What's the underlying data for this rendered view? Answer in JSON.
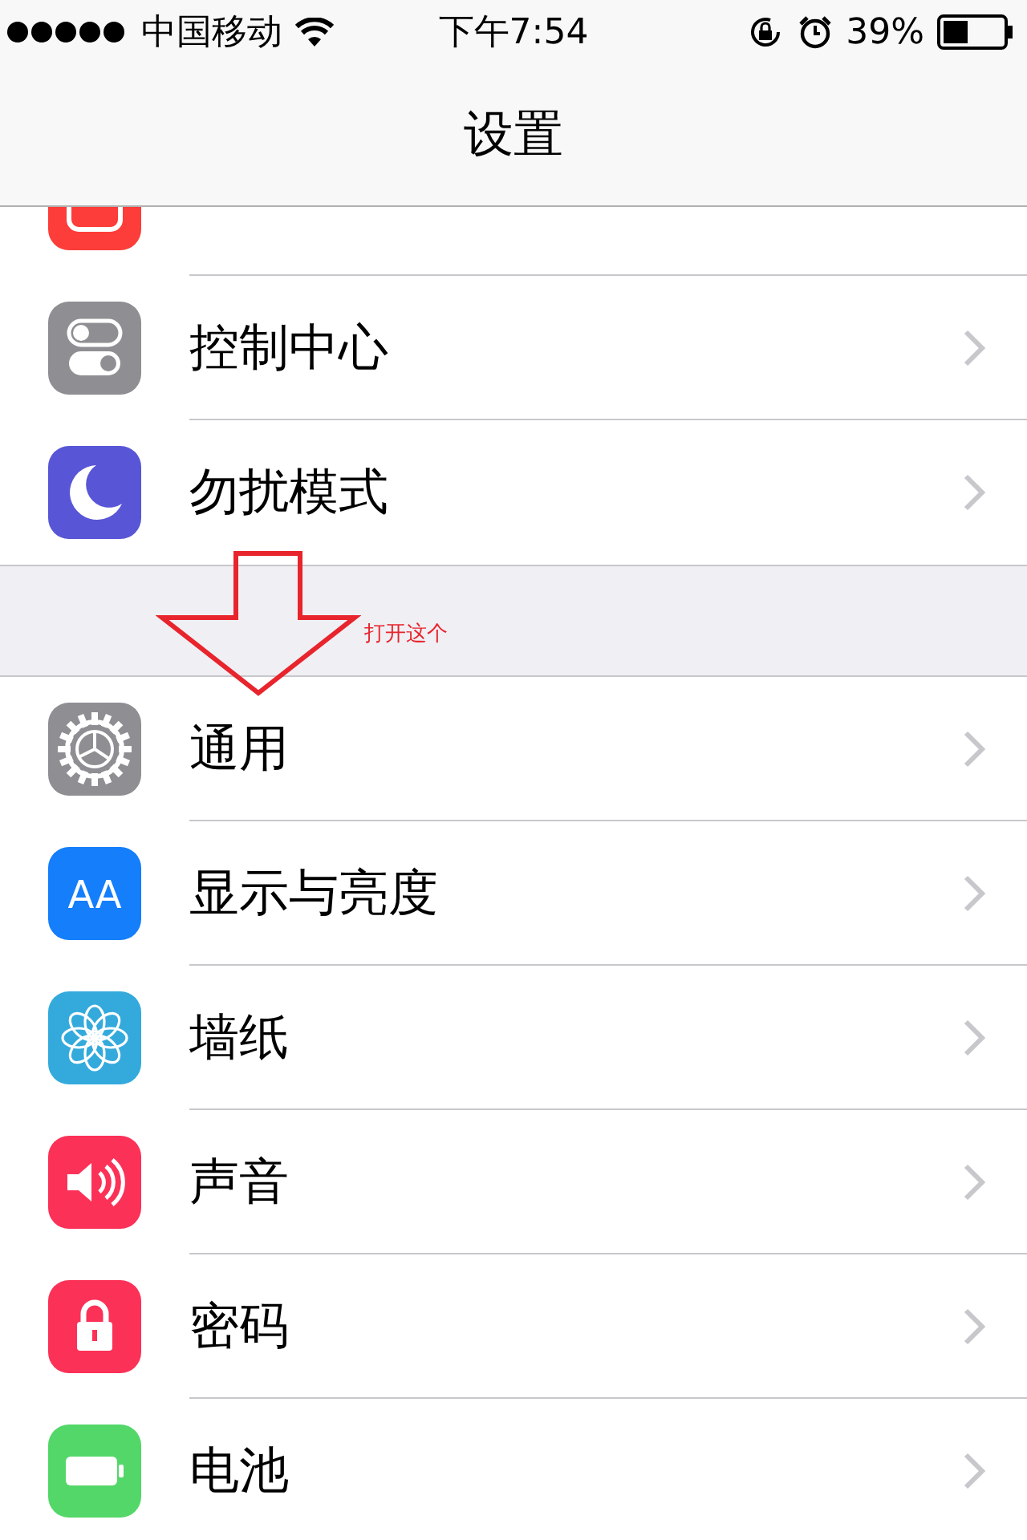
{
  "status_bar": {
    "carrier": "中国移动",
    "time": "下午7:54",
    "battery": "39%"
  },
  "nav_bar": {
    "title": "设置"
  },
  "groups": [
    {
      "rows": [
        {
          "kind": "notifications",
          "color": "#fc3d39"
        },
        {
          "label": "控制中心",
          "kind": "toggles",
          "color": "#8e8e93"
        },
        {
          "label": "勿扰模式",
          "kind": "moon",
          "color": "#5856d6"
        }
      ]
    },
    {
      "rows": [
        {
          "label": "通用",
          "kind": "gear",
          "color": "#8e8e93"
        },
        {
          "label": "显示与亮度",
          "kind": "textsize",
          "color": "#147efb",
          "icon_text": "AA"
        },
        {
          "label": "墙纸",
          "kind": "flower",
          "color": "#34aadc"
        },
        {
          "label": "声音",
          "kind": "speaker",
          "color": "#fc3158"
        },
        {
          "label": "密码",
          "kind": "lock",
          "color": "#fc3158"
        },
        {
          "label": "电池",
          "kind": "battery",
          "color": "#53d769"
        }
      ]
    }
  ],
  "annotation": {
    "text": "打开这个"
  }
}
